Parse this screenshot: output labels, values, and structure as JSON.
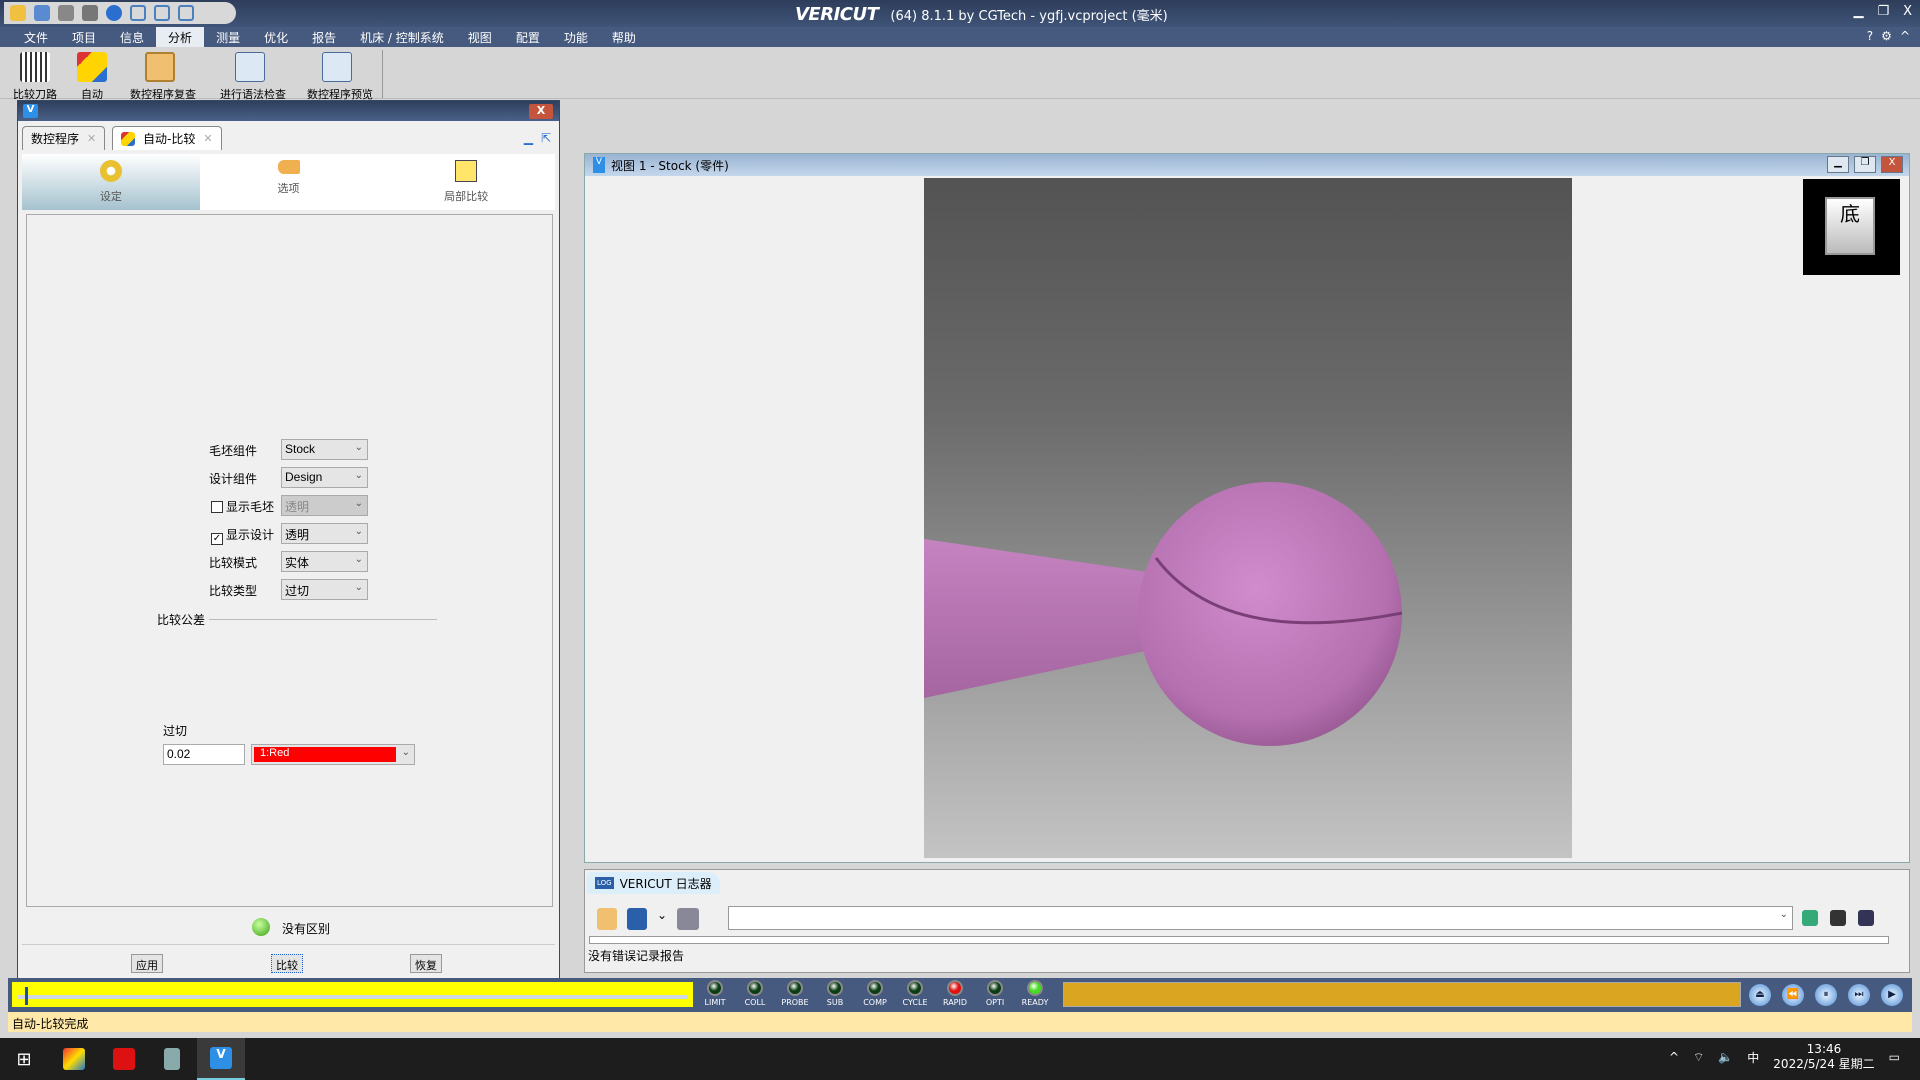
{
  "app": {
    "logo": "VERICUT",
    "title": "(64)  8.1.1 by CGTech - ygfj.vcproject (毫米)"
  },
  "menu": [
    "文件",
    "项目",
    "信息",
    "分析",
    "测量",
    "优化",
    "报告",
    "机床 / 控制系统",
    "视图",
    "配置",
    "功能",
    "帮助"
  ],
  "menu_active": "分析",
  "ribbon": [
    "比较刀路",
    "自动",
    "数控程序复查",
    "进行语法检查",
    "数控程序预览"
  ],
  "dialog": {
    "tabs": [
      {
        "label": "数控程序"
      },
      {
        "label": "自动-比较"
      }
    ],
    "subtabs": [
      {
        "label": "设定",
        "icon": "gear-icon"
      },
      {
        "label": "选项",
        "icon": "pointing-hand-icon"
      },
      {
        "label": "局部比较",
        "icon": "cube-icon"
      }
    ],
    "form": {
      "stock_label": "毛坯组件",
      "stock_value": "Stock",
      "design_label": "设计组件",
      "design_value": "Design",
      "show_stock_label": "显示毛坯",
      "show_stock_checked": false,
      "show_stock_value": "透明",
      "show_design_label": "显示设计",
      "show_design_checked": true,
      "show_design_value": "透明",
      "mode_label": "比较模式",
      "mode_value": "实体",
      "type_label": "比较类型",
      "type_value": "过切",
      "tolerance_group": "比较公差",
      "gouge_label": "过切",
      "gouge_value": "0.02",
      "gouge_color": "1:Red",
      "gouge_color_hex": "#ff0000"
    },
    "result": "没有区别",
    "buttons": {
      "apply": "应用",
      "compare": "比较",
      "reset": "恢复"
    }
  },
  "view": {
    "title": "视图 1 - Stock (零件)",
    "navcube_face": "底",
    "part_color": "#c77fc2"
  },
  "log": {
    "tab": "VERICUT 日志器",
    "message": "没有错误记录报告"
  },
  "status": {
    "progress": 0.01,
    "leds": [
      {
        "label": "LIMIT",
        "color": "#0b3d14"
      },
      {
        "label": "COLL",
        "color": "#0b3d14"
      },
      {
        "label": "PROBE",
        "color": "#0b3d14"
      },
      {
        "label": "SUB",
        "color": "#0b3d14"
      },
      {
        "label": "COMP",
        "color": "#0b3d14"
      },
      {
        "label": "CYCLE",
        "color": "#0b3d14"
      },
      {
        "label": "RAPID",
        "color": "#e01010"
      },
      {
        "label": "OPTI",
        "color": "#0b3d14"
      },
      {
        "label": "READY",
        "color": "#44dd22"
      }
    ],
    "message": "自动-比较完成"
  },
  "taskbar": {
    "time": "13:46",
    "date": "2022/5/24 星期二",
    "ime": "中"
  }
}
